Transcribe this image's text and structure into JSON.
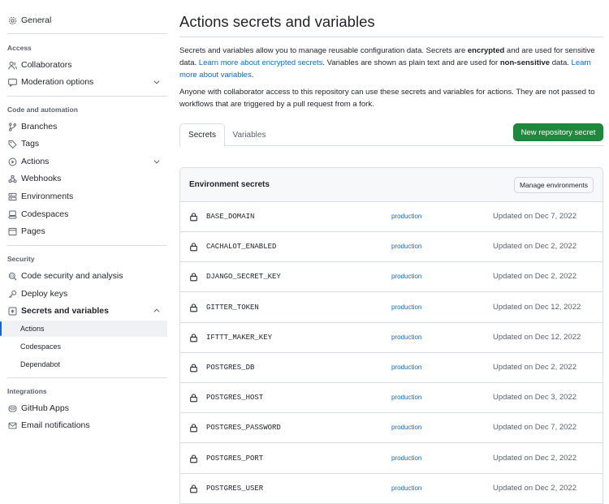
{
  "sidebar": {
    "general": "General",
    "access_heading": "Access",
    "collaborators": "Collaborators",
    "moderation": "Moderation options",
    "code_heading": "Code and automation",
    "branches": "Branches",
    "tags": "Tags",
    "actions": "Actions",
    "webhooks": "Webhooks",
    "environments": "Environments",
    "codespaces": "Codespaces",
    "pages": "Pages",
    "security_heading": "Security",
    "code_security": "Code security and analysis",
    "deploy_keys": "Deploy keys",
    "secrets": "Secrets and variables",
    "sub_actions": "Actions",
    "sub_codespaces": "Codespaces",
    "sub_dependabot": "Dependabot",
    "integrations_heading": "Integrations",
    "github_apps": "GitHub Apps",
    "email_notifications": "Email notifications"
  },
  "main": {
    "title": "Actions secrets and variables",
    "desc1_a": "Secrets and variables allow you to manage reusable configuration data. Secrets are ",
    "desc1_b": "encrypted",
    "desc1_c": " and are used for sensitive data. ",
    "desc1_link1": "Learn more about encrypted secrets",
    "desc1_d": ". Variables are shown as plain text and are used for ",
    "desc1_e": "non-sensitive",
    "desc1_f": " data. ",
    "desc1_link2": "Learn more about variables",
    "desc1_g": ".",
    "desc2": "Anyone with collaborator access to this repository can use these secrets and variables for actions. They are not passed to workflows that are triggered by a pull request from a fork.",
    "tabs": [
      "Secrets",
      "Variables"
    ],
    "new_button": "New repository secret",
    "box_title": "Environment secrets",
    "manage_button": "Manage environments",
    "secrets": [
      {
        "name": "BASE_DOMAIN",
        "env": "production",
        "updated": "Updated on Dec 7, 2022"
      },
      {
        "name": "CACHALOT_ENABLED",
        "env": "production",
        "updated": "Updated on Dec 2, 2022"
      },
      {
        "name": "DJANGO_SECRET_KEY",
        "env": "production",
        "updated": "Updated on Dec 2, 2022"
      },
      {
        "name": "GITTER_TOKEN",
        "env": "production",
        "updated": "Updated on Dec 12, 2022"
      },
      {
        "name": "IFTTT_MAKER_KEY",
        "env": "production",
        "updated": "Updated on Dec 12, 2022"
      },
      {
        "name": "POSTGRES_DB",
        "env": "production",
        "updated": "Updated on Dec 2, 2022"
      },
      {
        "name": "POSTGRES_HOST",
        "env": "production",
        "updated": "Updated on Dec 3, 2022"
      },
      {
        "name": "POSTGRES_PASSWORD",
        "env": "production",
        "updated": "Updated on Dec 7, 2022"
      },
      {
        "name": "POSTGRES_PORT",
        "env": "production",
        "updated": "Updated on Dec 2, 2022"
      },
      {
        "name": "POSTGRES_USER",
        "env": "production",
        "updated": "Updated on Dec 2, 2022"
      }
    ]
  },
  "colors": {
    "accent": "#0969da",
    "primary_button": "#1f883d",
    "border": "#d8dee4",
    "muted_text": "#59636e"
  }
}
